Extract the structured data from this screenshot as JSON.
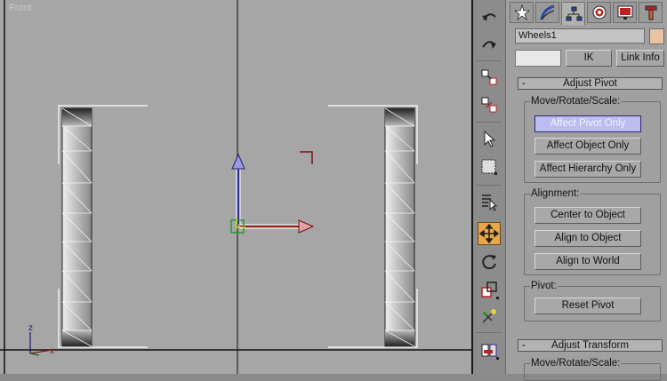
{
  "viewport": {
    "label": "Front",
    "axis": {
      "x": "x",
      "z": "z"
    }
  },
  "toolbar": {
    "items": [
      {
        "icon": "undo-icon"
      },
      {
        "icon": "redo-icon"
      },
      {
        "icon": "select-and-link-icon"
      },
      {
        "icon": "unlink-selection-icon"
      },
      {
        "icon": "select-object-icon"
      },
      {
        "icon": "select-region-icon"
      },
      {
        "icon": "select-by-name-icon"
      },
      {
        "icon": "select-and-move-icon",
        "active": true
      },
      {
        "icon": "select-and-rotate-icon"
      },
      {
        "icon": "select-and-scale-icon"
      },
      {
        "icon": "select-and-manipulate-icon"
      },
      {
        "icon": "mirror-align-icon"
      }
    ]
  },
  "command_panel": {
    "tabs": [
      {
        "icon": "create-tab-icon"
      },
      {
        "icon": "modify-tab-icon"
      },
      {
        "icon": "hierarchy-tab-icon",
        "active": true
      },
      {
        "icon": "motion-tab-icon"
      },
      {
        "icon": "display-tab-icon"
      },
      {
        "icon": "utilities-tab-icon"
      }
    ],
    "object_name": "Wheels1",
    "object_color": "#e8c4a4",
    "sub_tabs": {
      "pivot": "",
      "ik": "IK",
      "link_info": "Link Info"
    },
    "adjust_pivot": {
      "title": "Adjust Pivot",
      "collapse": "-",
      "move_group": {
        "label": "Move/Rotate/Scale:",
        "affect_pivot_only": "Affect Pivot Only",
        "affect_object_only": "Affect Object Only",
        "affect_hierarchy_only": "Affect Hierarchy Only"
      },
      "alignment_group": {
        "label": "Alignment:",
        "center_to_object": "Center to Object",
        "align_to_object": "Align to Object",
        "align_to_world": "Align to World"
      },
      "pivot_group": {
        "label": "Pivot:",
        "reset_pivot": "Reset Pivot"
      }
    },
    "adjust_transform": {
      "title": "Adjust Transform",
      "collapse": "-",
      "move_label": "Move/Rotate/Scale:"
    }
  }
}
